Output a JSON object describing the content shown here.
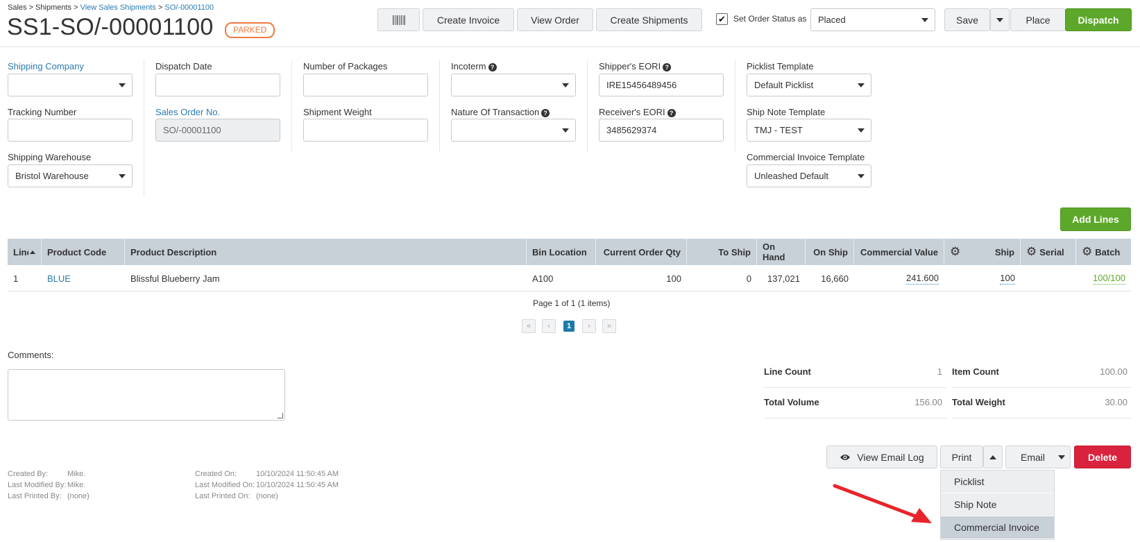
{
  "breadcrumb": {
    "part1": "Sales > Shipments > ",
    "link1": "View Sales Shipments",
    "sep": " > ",
    "link2": "SO/-00001100"
  },
  "header": {
    "title": "SS1-SO/-00001100",
    "status": "PARKED",
    "create_invoice": "Create Invoice",
    "view_order": "View Order",
    "create_shipments": "Create Shipments",
    "set_status_label": "Set Order Status as",
    "order_status": "Placed",
    "save": "Save",
    "place": "Place",
    "dispatch": "Dispatch"
  },
  "form": {
    "shipping_company_label": "Shipping Company",
    "shipping_company": "",
    "tracking_number_label": "Tracking Number",
    "tracking_number": "",
    "shipping_warehouse_label": "Shipping Warehouse",
    "shipping_warehouse": "Bristol Warehouse",
    "dispatch_date_label": "Dispatch Date",
    "dispatch_date": "",
    "sales_order_no_label": "Sales Order No.",
    "sales_order_no": "SO/-00001100",
    "num_packages_label": "Number of Packages",
    "num_packages": "",
    "shipment_weight_label": "Shipment Weight",
    "shipment_weight": "",
    "incoterm_label": "Incoterm",
    "incoterm": "",
    "nature_label": "Nature Of Transaction",
    "nature": "",
    "shipper_eori_label": "Shipper's EORI",
    "shipper_eori": "IRE15456489456",
    "receiver_eori_label": "Receiver's EORI",
    "receiver_eori": "3485629374",
    "picklist_template_label": "Picklist Template",
    "picklist_template": "Default Picklist",
    "ship_note_template_label": "Ship Note Template",
    "ship_note_template": "TMJ - TEST",
    "commercial_invoice_template_label": "Commercial Invoice Template",
    "commercial_invoice_template": "Unleashed Default"
  },
  "add_lines": "Add Lines",
  "table": {
    "columns": {
      "line": "Line",
      "product_code": "Product Code",
      "product_description": "Product Description",
      "bin_location": "Bin Location",
      "current_order_qty": "Current Order Qty",
      "to_ship": "To Ship",
      "on_hand": "On Hand",
      "on_ship": "On Ship",
      "commercial_value": "Commercial Value",
      "ship": "Ship",
      "serial": "Serial",
      "batch": "Batch"
    },
    "rows": [
      {
        "line": "1",
        "product_code": "BLUE",
        "product_description": "Blissful Blueberry Jam",
        "bin_location": "A100",
        "current_order_qty": "100",
        "to_ship": "0",
        "on_hand": "137,021",
        "on_ship": "16,660",
        "commercial_value": "241.600",
        "ship": "100",
        "batch": "100/100"
      }
    ],
    "pager_text": "Page 1 of 1 (1 items)",
    "current_page": "1"
  },
  "comments_label": "Comments:",
  "summary": {
    "line_count_label": "Line Count",
    "line_count": "1",
    "item_count_label": "Item Count",
    "item_count": "100.00",
    "total_volume_label": "Total Volume",
    "total_volume": "156.00",
    "total_weight_label": "Total Weight",
    "total_weight": "30.00"
  },
  "actions": {
    "view_email_log": "View Email Log",
    "print": "Print",
    "email": "Email",
    "delete": "Delete"
  },
  "print_menu": [
    "Picklist",
    "Ship Note",
    "Commercial Invoice"
  ],
  "meta": {
    "created_by_label": "Created By:",
    "created_by": "Mike.",
    "last_modified_by_label": "Last Modified By:",
    "last_modified_by": "Mike.",
    "last_printed_by_label": "Last Printed By:",
    "last_printed_by": "(none)",
    "created_on_label": "Created On:",
    "created_on": "10/10/2024 11:50:45 AM",
    "last_modified_on_label": "Last Modified On:",
    "last_modified_on": "10/10/2024 11:50:45 AM",
    "last_printed_on_label": "Last Printed On:",
    "last_printed_on": "(none)"
  },
  "colors": {
    "accent_green": "#5da82a",
    "danger_red": "#d9223d",
    "link_blue": "#2a7ab0",
    "badge_orange": "#f07b3f",
    "annotation_arrow": "#e8252b"
  },
  "icons": {
    "barcode": "barcode-icon",
    "eye": "eye-icon",
    "gear": "gear-icon",
    "help": "question-circle-icon"
  }
}
